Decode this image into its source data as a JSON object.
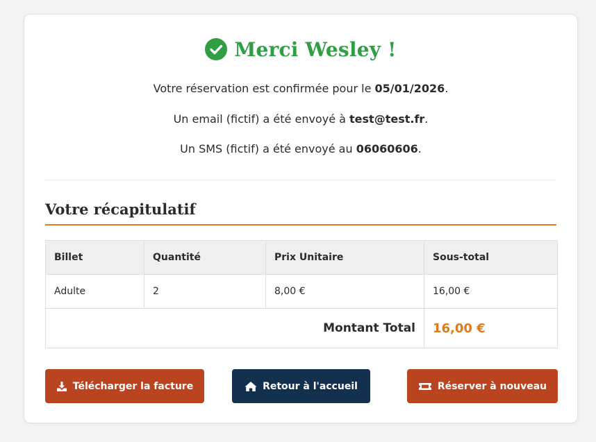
{
  "confirmation": {
    "title": "Merci Wesley !",
    "reservation_prefix": "Votre réservation est confirmée pour le ",
    "reservation_date": "05/01/2026",
    "email_prefix": "Un email (fictif) a été envoyé à ",
    "email": "test@test.fr",
    "sms_prefix": "Un SMS (fictif) a été envoyé au ",
    "phone": "06060606",
    "period": "."
  },
  "recap": {
    "title": "Votre récapitulatif",
    "headers": [
      "Billet",
      "Quantité",
      "Prix Unitaire",
      "Sous-total"
    ],
    "rows": [
      [
        "Adulte",
        "2",
        "8,00 €",
        "16,00 €"
      ]
    ],
    "total_label": "Montant Total",
    "total_value": "16,00 €"
  },
  "actions": {
    "download_label": "Télécharger la facture",
    "home_label": "Retour à l'accueil",
    "rebook_label": "Réserver à nouveau"
  },
  "colors": {
    "success": "#2f9e44",
    "accent": "#e07b1a",
    "primary_button": "#bb4420",
    "secondary_button": "#13304f"
  },
  "icons": {
    "title": "check-circle-icon",
    "download": "download-icon",
    "home": "home-icon",
    "rebook": "ticket-icon"
  }
}
